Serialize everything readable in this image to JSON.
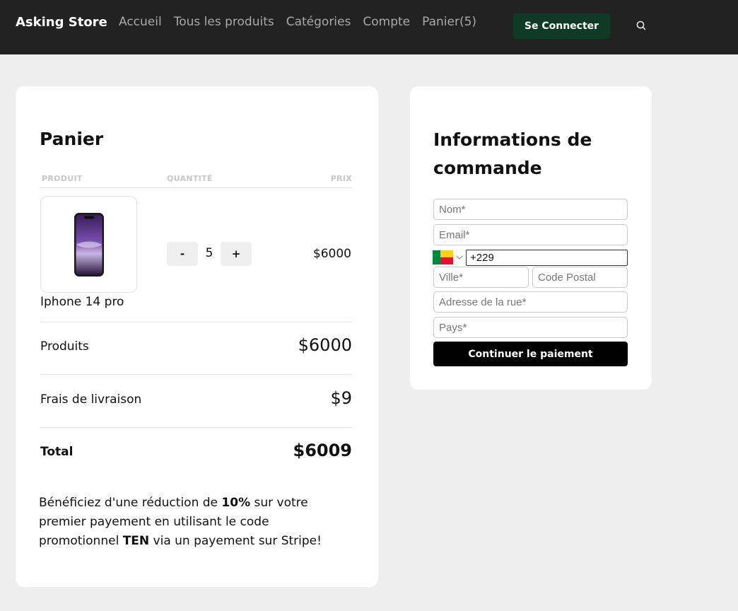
{
  "header": {
    "brand": "Asking Store",
    "nav": [
      "Accueil",
      "Tous les produits",
      "Catégories",
      "Compte",
      "Panier(5)"
    ],
    "login_label": "Se Connecter",
    "search_icon": "search-icon"
  },
  "cart": {
    "title": "Panier",
    "columns": {
      "product": "PRODUIT",
      "quantity": "QUANTITÉ",
      "price": "PRIX"
    },
    "item": {
      "name": "Iphone 14 pro",
      "quantity": "5",
      "minus_label": "-",
      "plus_label": "+",
      "price": "$6000"
    },
    "summary": {
      "products_label": "Produits",
      "products_value": "$6000",
      "shipping_label": "Frais de livraison",
      "shipping_value": "$9",
      "total_label": "Total",
      "total_value": "$6009"
    },
    "promo": {
      "part1": "Bénéficiez d'une réduction de ",
      "discount": "10%",
      "part2": " sur votre premier payement en utilisant le code promotionnel ",
      "code": "TEN",
      "part3": " via un payement sur Stripe!"
    }
  },
  "order": {
    "title": "Informations de commande",
    "fields": {
      "name_placeholder": "Nom*",
      "email_placeholder": "Email*",
      "phone_value": "+229",
      "city_placeholder": "Ville*",
      "postal_placeholder": "Code Postal",
      "address_placeholder": "Adresse de la rue*",
      "country_placeholder": "Pays*"
    },
    "country_flag": "benin-flag-icon",
    "submit_label": "Continuer le paiement"
  },
  "colors": {
    "header_bg": "#222222",
    "login_btn": "#0f3a26",
    "page_bg": "#eeeeee",
    "pay_btn": "#000000"
  }
}
